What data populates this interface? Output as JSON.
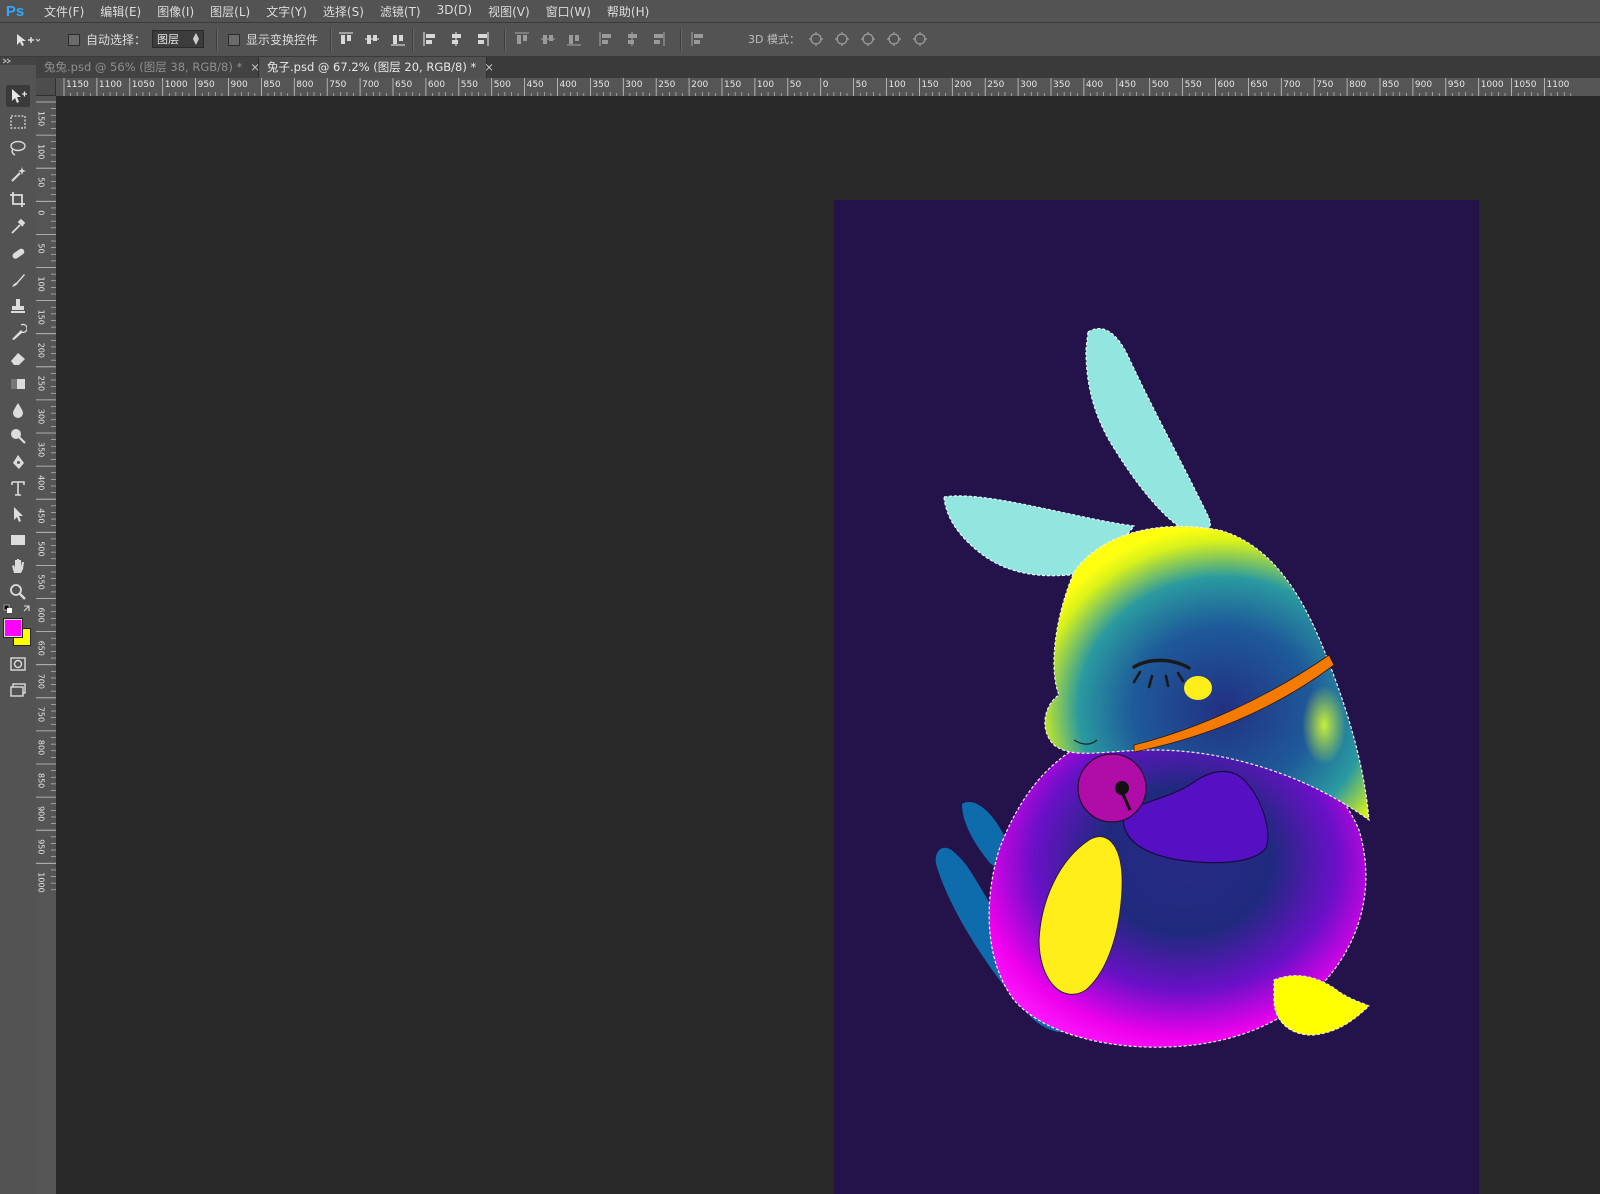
{
  "app": {
    "logo": "Ps"
  },
  "menu": [
    "文件(F)",
    "编辑(E)",
    "图像(I)",
    "图层(L)",
    "文字(Y)",
    "选择(S)",
    "滤镜(T)",
    "3D(D)",
    "视图(V)",
    "窗口(W)",
    "帮助(H)"
  ],
  "options": {
    "auto_select_label": "自动选择：",
    "auto_select_value": "图层",
    "show_transform_label": "显示变换控件",
    "mode_3d_label": "3D 模式："
  },
  "tabs": [
    {
      "label": "兔兔.psd @ 56% (图层 38, RGB/8) *",
      "active": false
    },
    {
      "label": "兔子.psd @ 67.2% (图层 20, RGB/8) *",
      "active": true
    }
  ],
  "ruler_h_labels": [
    "1150",
    "1100",
    "1050",
    "1000",
    "950",
    "900",
    "850",
    "800",
    "750",
    "700",
    "650",
    "600",
    "550",
    "500",
    "450",
    "400",
    "350",
    "300",
    "250",
    "200",
    "150",
    "100",
    "50",
    "0",
    "50",
    "100",
    "150",
    "200",
    "250",
    "300",
    "350",
    "400",
    "450",
    "500",
    "550",
    "600",
    "650",
    "700",
    "750",
    "800",
    "850",
    "900",
    "950",
    "1000",
    "1050",
    "1100"
  ],
  "ruler_v_labels": [
    "150",
    "100",
    "50",
    "0",
    "50",
    "100",
    "150",
    "200",
    "250",
    "300",
    "350",
    "400",
    "450",
    "500",
    "550",
    "600",
    "650",
    "700",
    "750",
    "800",
    "850",
    "900",
    "950",
    "1000"
  ],
  "colors": {
    "foreground": "#ff00ff",
    "background": "#ffff00",
    "artboard": "#24124b",
    "ears": "#93e6e0",
    "collar": "#f57a00",
    "bell": "#b00ca8",
    "paw": "#5510c4",
    "leg": "#0e6cac",
    "highlight_yellow": "#ffee1a"
  },
  "toolbox_icons": [
    "move-icon",
    "marquee-icon",
    "lasso-icon",
    "magic-wand-icon",
    "crop-icon",
    "eyedropper-icon",
    "healing-brush-icon",
    "brush-icon",
    "clone-stamp-icon",
    "history-brush-icon",
    "eraser-icon",
    "gradient-icon",
    "blur-icon",
    "dodge-icon",
    "pen-icon",
    "type-icon",
    "path-selection-icon",
    "rectangle-icon",
    "hand-icon",
    "zoom-icon",
    "quick-mask-icon",
    "screen-mode-icon"
  ]
}
